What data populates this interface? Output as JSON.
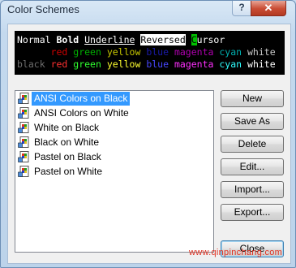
{
  "window": {
    "title": "Color Schemes",
    "help_label": "?",
    "close_label": "✕"
  },
  "preview": {
    "line1": [
      {
        "text": "Normal",
        "fg": "#ffffff",
        "bg": "#000000"
      },
      {
        "text": " ",
        "fg": "#ffffff",
        "bg": "#000000"
      },
      {
        "text": "Bold",
        "fg": "#ffffff",
        "bg": "#000000",
        "bold": true
      },
      {
        "text": " ",
        "fg": "#ffffff",
        "bg": "#000000"
      },
      {
        "text": "Underline",
        "fg": "#ffffff",
        "bg": "#000000",
        "underline": true
      },
      {
        "text": " ",
        "fg": "#ffffff",
        "bg": "#000000"
      },
      {
        "text": "Reversed",
        "fg": "#000000",
        "bg": "#ffffff"
      },
      {
        "text": " ",
        "fg": "#ffffff",
        "bg": "#000000"
      },
      {
        "text": "C",
        "fg": "#000000",
        "bg": "#00c000"
      },
      {
        "text": "ursor",
        "fg": "#ffffff",
        "bg": "#000000"
      }
    ],
    "line2": [
      {
        "text": "      ",
        "fg": "#ffffff"
      },
      {
        "text": "red",
        "fg": "#cc0000"
      },
      {
        "text": " ",
        "fg": "#ffffff"
      },
      {
        "text": "green",
        "fg": "#00b000"
      },
      {
        "text": " ",
        "fg": "#ffffff"
      },
      {
        "text": "yellow",
        "fg": "#c8c800"
      },
      {
        "text": " ",
        "fg": "#ffffff"
      },
      {
        "text": "blue",
        "fg": "#1a1aa8"
      },
      {
        "text": " ",
        "fg": "#ffffff"
      },
      {
        "text": "magenta",
        "fg": "#b000b0"
      },
      {
        "text": " ",
        "fg": "#ffffff"
      },
      {
        "text": "cyan",
        "fg": "#00b0b0"
      },
      {
        "text": " ",
        "fg": "#ffffff"
      },
      {
        "text": "white",
        "fg": "#c8c8c8"
      }
    ],
    "line3": [
      {
        "text": "black",
        "fg": "#6e6e6e"
      },
      {
        "text": " ",
        "fg": "#ffffff"
      },
      {
        "text": "red",
        "fg": "#ff3030"
      },
      {
        "text": " ",
        "fg": "#ffffff"
      },
      {
        "text": "green",
        "fg": "#30ff30"
      },
      {
        "text": " ",
        "fg": "#ffffff"
      },
      {
        "text": "yellow",
        "fg": "#ffff30"
      },
      {
        "text": " ",
        "fg": "#ffffff"
      },
      {
        "text": "blue",
        "fg": "#4848ff"
      },
      {
        "text": " ",
        "fg": "#ffffff"
      },
      {
        "text": "magenta",
        "fg": "#ff30ff"
      },
      {
        "text": " ",
        "fg": "#ffffff"
      },
      {
        "text": "cyan",
        "fg": "#30ffff"
      },
      {
        "text": " ",
        "fg": "#ffffff"
      },
      {
        "text": "white",
        "fg": "#ffffff"
      }
    ]
  },
  "schemes": [
    {
      "label": "ANSI Colors on Black",
      "selected": true
    },
    {
      "label": "ANSI Colors on White",
      "selected": false
    },
    {
      "label": "White on Black",
      "selected": false
    },
    {
      "label": "Black on White",
      "selected": false
    },
    {
      "label": "Pastel on Black",
      "selected": false
    },
    {
      "label": "Pastel on White",
      "selected": false
    }
  ],
  "buttons": {
    "new": "New",
    "save_as": "Save As",
    "delete": "Delete",
    "edit": "Edit...",
    "import": "Import...",
    "export": "Export...",
    "close": "Close"
  },
  "watermark": "www.qinpinchang.com",
  "colors": {
    "selection": "#3399ff",
    "title_bar": "#c4d9ee"
  }
}
